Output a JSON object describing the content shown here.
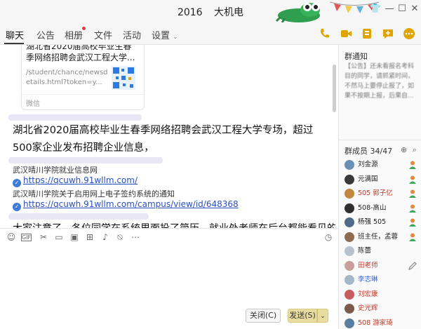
{
  "window": {
    "title_num": "2016",
    "title_name": "大机电",
    "controls": [
      "shirt-icon",
      "minimize-icon",
      "maximize-icon",
      "close-icon"
    ]
  },
  "tabs": [
    {
      "label": "聊天",
      "active": true
    },
    {
      "label": "公告"
    },
    {
      "label": "相册",
      "dot": true
    },
    {
      "label": "文件"
    },
    {
      "label": "活动"
    },
    {
      "label": "设置",
      "dropdown": true
    }
  ],
  "toolbar_icons": [
    "phone-icon",
    "video-icon",
    "share-screen-icon",
    "message-icon",
    "more-icon"
  ],
  "chat": {
    "card": {
      "title": "湖北省2020届高校毕业生春季网络招聘会武汉工程大学...",
      "url": "/student/chance/newsdetails.html?token=y...",
      "source": "微信"
    },
    "message": "湖北省2020届高校毕业生春季网络招聘会武汉工程大学专场，超过500家企业发布招聘企业信息，",
    "links": [
      {
        "label": "武汉晴川学院就业信息网",
        "url": "https://qcuwh.91wllm.com/"
      },
      {
        "label": "武汉晴川学院关于启用网上电子签约系统的通知",
        "url": "https://qcuwh.91wllm.com/campus/view/id/648368"
      }
    ],
    "partial_message": "大家注意了，各位同学在系统里面投了简历，就业处老师在后台都能看见的，并且以"
  },
  "compose": {
    "tools": [
      "emoji-icon",
      "gif-icon",
      "scissors-icon",
      "folder-icon",
      "image-icon",
      "gift-icon",
      "voice-icon",
      "mute-bell-icon",
      "more-circle-icon"
    ],
    "history_icon": "clock-icon",
    "close_label": "关闭(C)",
    "send_label": "发送(S)"
  },
  "right": {
    "notice_title": "群通知",
    "notice_text": "【公告】还未看报名考科目的同学，请抓紧时间，不然马上要停止报了，如果不按期上报，后果自...",
    "members_title": "群成员",
    "members_count": "34/47",
    "members": [
      {
        "name": "刘金源",
        "color": "#222222",
        "avatar": "#6b8fb5",
        "badge": "person-icon"
      },
      {
        "name": "元满国",
        "color": "#222222",
        "avatar": "#3a3a3a",
        "badge": "person-icon"
      },
      {
        "name": "505 郭子亿",
        "color": "#c0392b",
        "avatar": "#c2873e",
        "badge": "person-icon"
      },
      {
        "name": "508-高山",
        "color": "#222222",
        "avatar": "#2f2f2f",
        "badge": "person-icon"
      },
      {
        "name": "杨强 505",
        "color": "#222222",
        "avatar": "#4f6b88",
        "badge": "person-icon"
      },
      {
        "name": "班主任，孟蓉",
        "color": "#222222",
        "avatar": "#8c6d52",
        "badge": "person-icon"
      },
      {
        "name": "陈蕾",
        "color": "#222222",
        "avatar": "#b7c2cd",
        "badge": ""
      },
      {
        "name": "田老师",
        "color": "#c0392b",
        "avatar": "#c89f9a",
        "badge": "pencil-icon"
      },
      {
        "name": "李志琳",
        "color": "#3a63c9",
        "avatar": "#a4b8c8",
        "badge": ""
      },
      {
        "name": "刘宏康",
        "color": "#c0392b",
        "avatar": "#c85d5d",
        "badge": ""
      },
      {
        "name": "史光辉",
        "color": "#c0392b",
        "avatar": "#7a5a4a",
        "badge": ""
      },
      {
        "name": "508 游家琦",
        "color": "#c0392b",
        "avatar": "#5a7fa0",
        "badge": ""
      }
    ]
  }
}
